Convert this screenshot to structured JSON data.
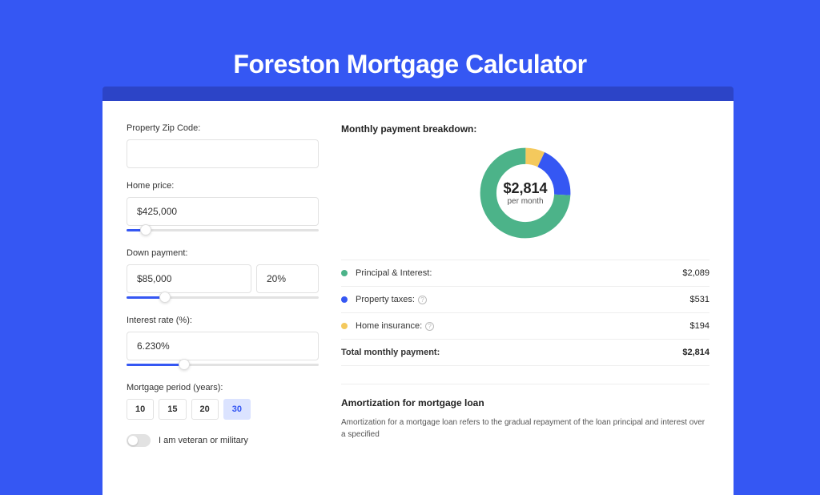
{
  "header": {
    "title": "Foreston Mortgage Calculator"
  },
  "form": {
    "zip_label": "Property Zip Code:",
    "zip_value": "",
    "price_label": "Home price:",
    "price_value": "$425,000",
    "down_label": "Down payment:",
    "down_value": "$85,000",
    "down_pct": "20%",
    "rate_label": "Interest rate (%):",
    "rate_value": "6.230%",
    "period_label": "Mortgage period (years):",
    "periods": [
      "10",
      "15",
      "20",
      "30"
    ],
    "period_active_index": 3,
    "veteran_label": "I am veteran or military"
  },
  "breakdown": {
    "heading": "Monthly payment breakdown:",
    "total_amount": "$2,814",
    "total_sub": "per month",
    "rows": [
      {
        "label": "Principal & Interest:",
        "value": "$2,089",
        "color": "green",
        "info": false
      },
      {
        "label": "Property taxes:",
        "value": "$531",
        "color": "blue",
        "info": true
      },
      {
        "label": "Home insurance:",
        "value": "$194",
        "color": "yellow",
        "info": true
      }
    ],
    "total_label": "Total monthly payment:",
    "total_value": "$2,814"
  },
  "chart_data": {
    "type": "pie",
    "title": "",
    "series": [
      {
        "name": "Principal & Interest",
        "value": 2089,
        "color": "#4cb389"
      },
      {
        "name": "Property taxes",
        "value": 531,
        "color": "#3557f3"
      },
      {
        "name": "Home insurance",
        "value": 194,
        "color": "#f4c95d"
      }
    ],
    "center_label": "$2,814",
    "center_sub": "per month"
  },
  "amortization": {
    "heading": "Amortization for mortgage loan",
    "text": "Amortization for a mortgage loan refers to the gradual repayment of the loan principal and interest over a specified"
  }
}
